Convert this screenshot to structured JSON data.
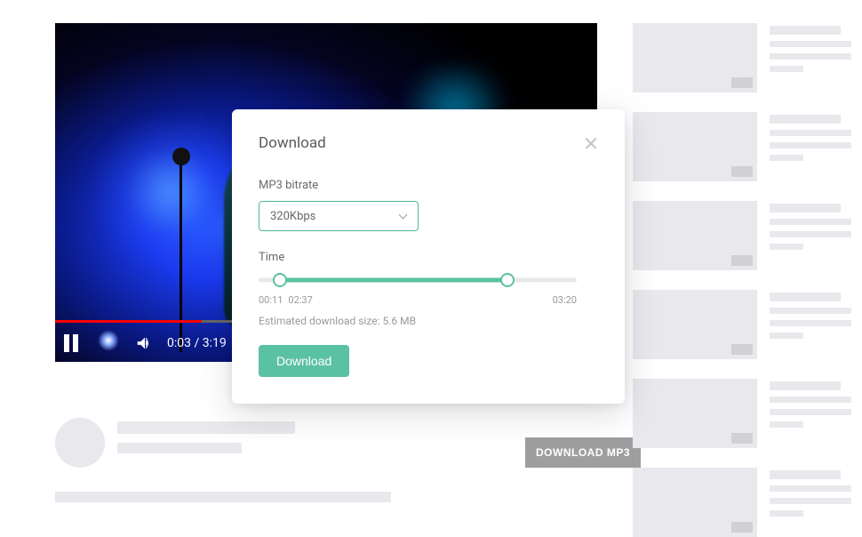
{
  "video": {
    "current_time": "0:03",
    "duration": "3:19",
    "progress_percent": 27
  },
  "download_mp3_button": "DOWNLOAD MP3",
  "modal": {
    "title": "Download",
    "bitrate_label": "MP3 bitrate",
    "bitrate_value": "320Kbps",
    "time_label": "Time",
    "time_start": "00:11",
    "time_end": "02:37",
    "time_total": "03:20",
    "estimated_size_label": "Estimated download size:",
    "estimated_size_value": "5.6 MB",
    "download_button": "Download"
  }
}
